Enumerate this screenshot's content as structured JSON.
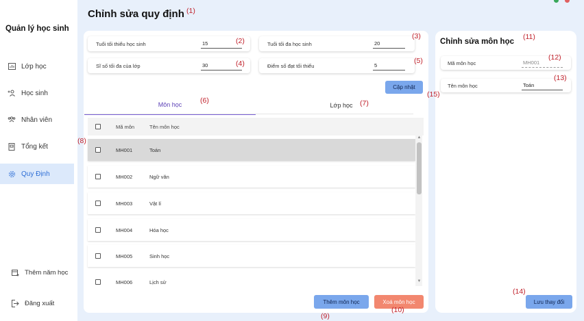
{
  "sidebar": {
    "app_title": "Quản lý học sinh",
    "items": [
      {
        "label": "Lớp học",
        "icon": "chart-icon"
      },
      {
        "label": "Học sinh",
        "icon": "add-user-icon"
      },
      {
        "label": "Nhân viên",
        "icon": "users-icon"
      },
      {
        "label": "Tổng kết",
        "icon": "document-icon"
      },
      {
        "label": "Quy Định",
        "icon": "gear-icon"
      }
    ],
    "active_item": "Quy Định",
    "bottom": {
      "add_year": "Thêm năm học",
      "logout": "Đăng xuất"
    }
  },
  "page": {
    "title": "Chỉnh sửa quy định"
  },
  "regulations": {
    "min_age": {
      "label": "Tuổi tối thiểu học sinh",
      "value": "15"
    },
    "max_age": {
      "label": "Tuổi tối đa học sinh",
      "value": "20"
    },
    "max_class_size": {
      "label": "Sĩ số tối đa của lớp",
      "value": "30"
    },
    "min_pass_score": {
      "label": "Điểm số đạt tối thiểu",
      "value": "5"
    },
    "update_button": "Cập nhật"
  },
  "tabs": [
    {
      "label": "Môn học",
      "active": true
    },
    {
      "label": "Lớp học",
      "active": false
    }
  ],
  "subjects_table": {
    "columns": [
      "Mã môn",
      "Tên môn học"
    ],
    "rows": [
      {
        "code": "MH001",
        "name": "Toán",
        "selected": true
      },
      {
        "code": "MH002",
        "name": "Ngữ văn",
        "selected": false
      },
      {
        "code": "MH003",
        "name": "Vật lí",
        "selected": false
      },
      {
        "code": "MH004",
        "name": "Hóa học",
        "selected": false
      },
      {
        "code": "MH005",
        "name": "Sinh học",
        "selected": false
      },
      {
        "code": "MH006",
        "name": "Lịch sử",
        "selected": false
      }
    ],
    "add_button": "Thêm môn học",
    "delete_button": "Xoá môn học"
  },
  "subject_editor": {
    "title": "Chỉnh sửa môn học",
    "code_label": "Mã môn học",
    "code_value": "MH001",
    "name_label": "Tên môn học",
    "name_value": "Toán",
    "save_button": "Lưu thay đổi"
  },
  "callouts": [
    "(1)",
    "(2)",
    "(3)",
    "(4)",
    "(5)",
    "(6)",
    "(7)",
    "(8)",
    "(9)",
    "(10)",
    "(11)",
    "(12)",
    "(13)",
    "(14)",
    "(15)"
  ],
  "colors": {
    "background": "#e8f0fb",
    "active_nav": "#dce9fb",
    "accent_blue": "#7aa7ec",
    "danger": "#f2876f",
    "tab_accent": "#7a5fd6",
    "callout": "#c0202a"
  }
}
